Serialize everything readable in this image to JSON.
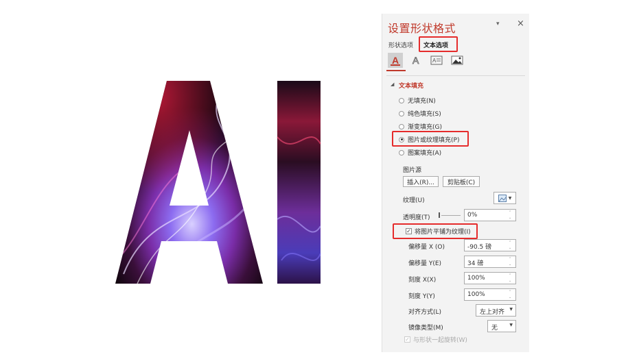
{
  "colors": {
    "accent": "#c0392b",
    "highlight_box": "#e52b2b",
    "panel_bg": "#f3f3f3",
    "letter_dark": "#1a0a18"
  },
  "canvas": {
    "letters": "AI"
  },
  "pane": {
    "title": "设置形状格式",
    "pin_icon": "▾",
    "close_icon": "×",
    "tabs": [
      {
        "label": "形状选项",
        "selected": false
      },
      {
        "label": "文本选项",
        "selected": true
      }
    ],
    "icons": [
      "text-fill-outline-icon",
      "text-effects-icon",
      "textbox-icon",
      "picture-icon"
    ],
    "section_title": "文本填充",
    "fill_options": [
      {
        "label": "无填充(N)",
        "checked": false
      },
      {
        "label": "纯色填充(S)",
        "checked": false
      },
      {
        "label": "渐变填充(G)",
        "checked": false
      },
      {
        "label": "图片或纹理填充(P)",
        "checked": true
      },
      {
        "label": "图案填充(A)",
        "checked": false
      }
    ],
    "picture_source_label": "图片源",
    "insert_button": "插入(R)...",
    "clipboard_button": "剪贴板(C)",
    "texture_label": "纹理(U)",
    "transparency_label": "透明度(T)",
    "transparency_value": "0%",
    "tile_checkbox_label": "将图片平铺为纹理(I)",
    "tile_checked": true,
    "offset_x_label": "偏移量 X (O)",
    "offset_x_value": "-90.5 磅",
    "offset_y_label": "偏移量 Y(E)",
    "offset_y_value": "34 磅",
    "scale_x_label": "刻度 X(X)",
    "scale_x_value": "100%",
    "scale_y_label": "刻度 Y(Y)",
    "scale_y_value": "100%",
    "alignment_label": "对齐方式(L)",
    "alignment_value": "左上对齐",
    "mirror_label": "镜像类型(M)",
    "mirror_value": "无",
    "rotate_label": "与形状一起旋转(W)",
    "rotate_checked": true,
    "rotate_disabled": true
  }
}
